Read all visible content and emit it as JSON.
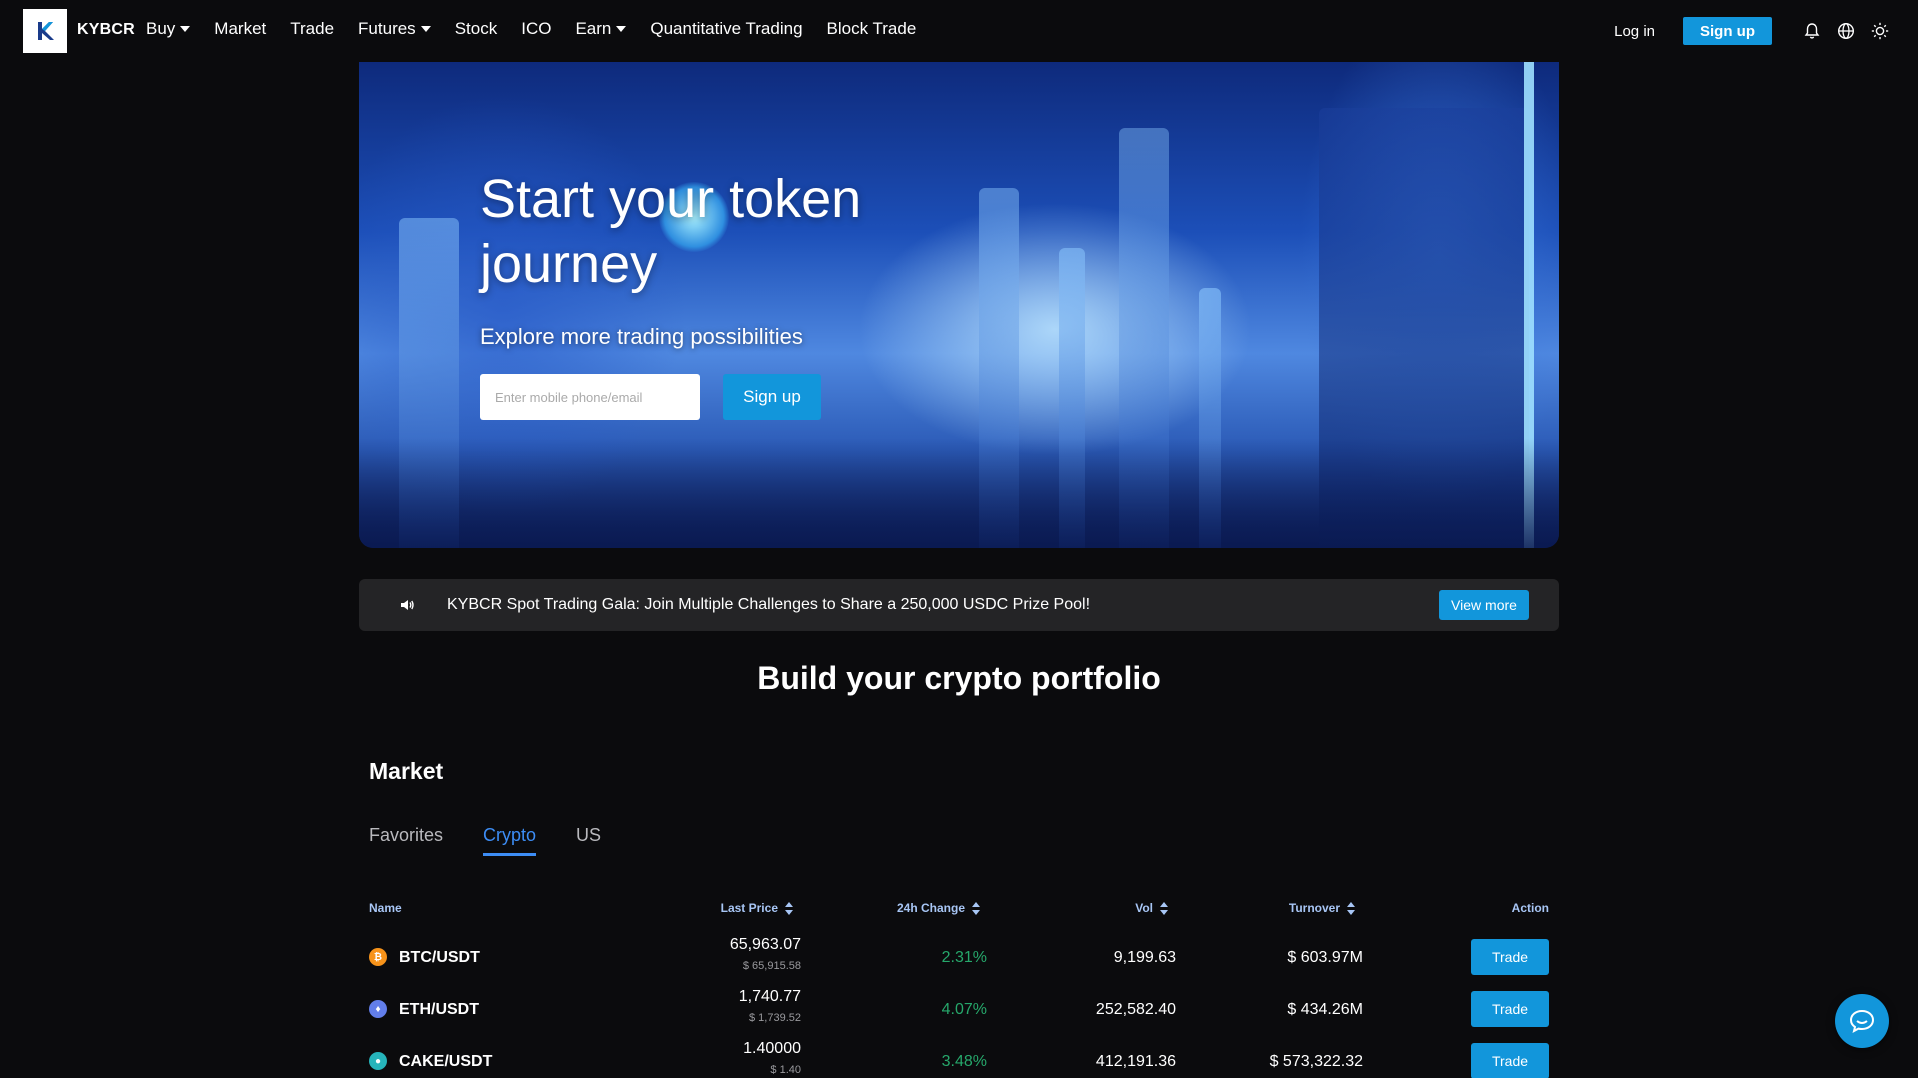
{
  "brand": {
    "name": "KYBCR"
  },
  "nav": {
    "items": [
      {
        "label": "Buy",
        "dropdown": true
      },
      {
        "label": "Market",
        "dropdown": false
      },
      {
        "label": "Trade",
        "dropdown": false
      },
      {
        "label": "Futures",
        "dropdown": true
      },
      {
        "label": "Stock",
        "dropdown": false
      },
      {
        "label": "ICO",
        "dropdown": false
      },
      {
        "label": "Earn",
        "dropdown": true
      },
      {
        "label": "Quantitative Trading",
        "dropdown": false
      },
      {
        "label": "Block Trade",
        "dropdown": false
      }
    ],
    "login": "Log in",
    "signup": "Sign up",
    "icons": [
      "bell-icon",
      "globe-icon",
      "sun-icon"
    ]
  },
  "hero": {
    "title": "Start your token journey",
    "subtitle": "Explore more trading possibilities",
    "input_placeholder": "Enter mobile phone/email",
    "signup": "Sign up"
  },
  "notice": {
    "text": "KYBCR Spot Trading Gala: Join Multiple Challenges to Share a 250,000 USDC Prize Pool!",
    "button": "View more"
  },
  "portfolio_title": "Build your crypto portfolio",
  "market": {
    "title": "Market",
    "tabs": [
      {
        "label": "Favorites",
        "active": false
      },
      {
        "label": "Crypto",
        "active": true
      },
      {
        "label": "US",
        "active": false
      }
    ],
    "columns": {
      "name": "Name",
      "last_price": "Last Price",
      "change": "24h Change",
      "vol": "Vol",
      "turnover": "Turnover",
      "action": "Action"
    },
    "rows": [
      {
        "pair": "BTC/USDT",
        "icon": "btc-icon",
        "color": "#f7931a",
        "glyph": "₿",
        "price": "65,963.07",
        "usd": "$ 65,915.58",
        "change": "2.31%",
        "vol": "9,199.63",
        "turnover": "$ 603.97M",
        "action": "Trade"
      },
      {
        "pair": "ETH/USDT",
        "icon": "eth-icon",
        "color": "#627eea",
        "glyph": "♦",
        "price": "1,740.77",
        "usd": "$ 1,739.52",
        "change": "4.07%",
        "vol": "252,582.40",
        "turnover": "$ 434.26M",
        "action": "Trade"
      },
      {
        "pair": "CAKE/USDT",
        "icon": "cake-icon",
        "color": "#26b4bb",
        "glyph": "●",
        "price": "1.40000",
        "usd": "$ 1.40",
        "change": "3.48%",
        "vol": "412,191.36",
        "turnover": "$ 573,322.32",
        "action": "Trade"
      }
    ]
  },
  "colors": {
    "accent": "#1296db",
    "positive": "#26a86b",
    "background": "#0b0b0d",
    "tab_active": "#3d8df5"
  }
}
